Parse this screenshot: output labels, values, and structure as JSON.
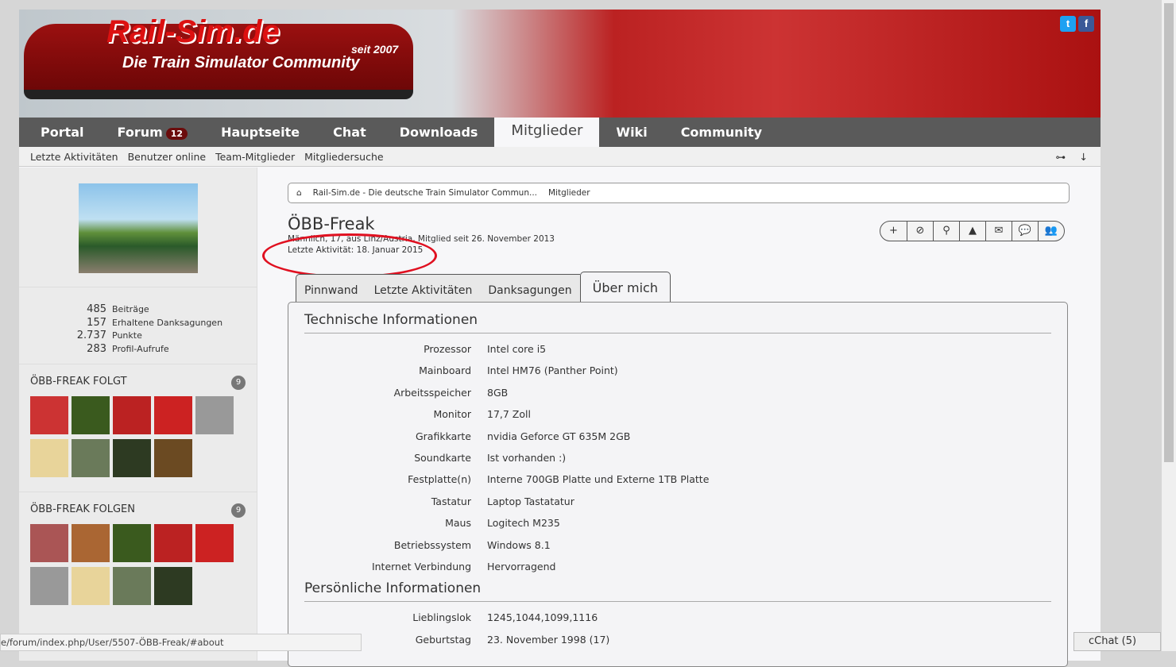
{
  "header": {
    "logo": "Rail-Sim.de",
    "slogan": "Die Train Simulator Community",
    "since": "seit 2007",
    "social": [
      "t",
      "f"
    ]
  },
  "nav": {
    "items": [
      "Portal",
      "Forum",
      "Hauptseite",
      "Chat",
      "Downloads",
      "Mitglieder",
      "Wiki",
      "Community"
    ],
    "forum_badge": "12",
    "active": "Mitglieder"
  },
  "subnav": {
    "items": [
      "Letzte Aktivitäten",
      "Benutzer online",
      "Team-Mitglieder",
      "Mitgliedersuche"
    ],
    "icons": [
      "sitemap-icon",
      "arrow-down-icon"
    ]
  },
  "sidebar": {
    "stats": [
      {
        "value": "485",
        "label": "Beiträge"
      },
      {
        "value": "157",
        "label": "Erhaltene Danksagungen"
      },
      {
        "value": "2.737",
        "label": "Punkte"
      },
      {
        "value": "283",
        "label": "Profil-Aufrufe"
      }
    ],
    "following": {
      "title": "ÖBB-FREAK FOLGT",
      "count": "9"
    },
    "followers": {
      "title": "ÖBB-FREAK FOLGEN",
      "count": "9"
    }
  },
  "breadcrumb": [
    "Rail-Sim.de - Die deutsche Train Simulator Commun...",
    "Mitglieder"
  ],
  "profile": {
    "name": "ÖBB-Freak",
    "meta": "Männlich, 17, aus Linz/Austria, Mitglied seit 26. November 2013",
    "last_activity": "Letzte Aktivität: 18. Januar 2015"
  },
  "tools": [
    "+",
    "⊘",
    "⚲",
    "▲",
    "✉",
    "💬",
    "👥"
  ],
  "tabs": [
    "Pinnwand",
    "Letzte Aktivitäten",
    "Danksagungen",
    "Über mich"
  ],
  "tech": {
    "title": "Technische Informationen",
    "rows": [
      {
        "k": "Prozessor",
        "v": "Intel core i5"
      },
      {
        "k": "Mainboard",
        "v": "Intel HM76 (Panther Point)"
      },
      {
        "k": "Arbeitsspeicher",
        "v": "8GB"
      },
      {
        "k": "Monitor",
        "v": "17,7 Zoll"
      },
      {
        "k": "Grafikkarte",
        "v": "nvidia Geforce GT 635M 2GB"
      },
      {
        "k": "Soundkarte",
        "v": "Ist vorhanden :)"
      },
      {
        "k": "Festplatte(n)",
        "v": "Interne 700GB Platte und Externe 1TB Platte"
      },
      {
        "k": "Tastatur",
        "v": "Laptop Tastatatur"
      },
      {
        "k": "Maus",
        "v": "Logitech M235"
      },
      {
        "k": "Betriebssystem",
        "v": "Windows 8.1"
      },
      {
        "k": "Internet Verbindung",
        "v": "Hervorragend"
      }
    ]
  },
  "personal": {
    "title": "Persönliche Informationen",
    "rows": [
      {
        "k": "Lieblingslok",
        "v": "1245,1044,1099,1116"
      },
      {
        "k": "Geburtstag",
        "v": "23. November 1998 (17)"
      }
    ]
  },
  "status_url": "e/forum/index.php/User/5507-ÖBB-Freak/#about",
  "cchat": "cChat (5)"
}
